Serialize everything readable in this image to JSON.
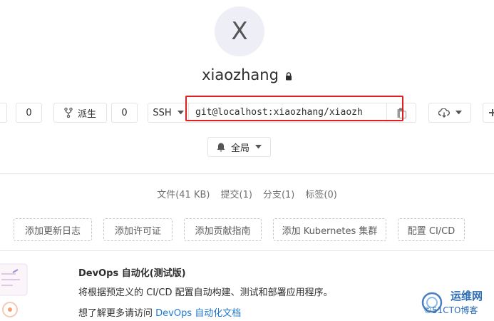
{
  "project": {
    "avatar_letter": "X",
    "name": "xiaozhang"
  },
  "toolbar": {
    "star_count": "0",
    "fork_label": "派生",
    "fork_count": "0",
    "protocol": "SSH",
    "clone_url": "git@localhost:xiaozhang/xiaozh"
  },
  "notification": {
    "level": "全局"
  },
  "stats": {
    "files_label": "文件",
    "files_size": "(41 KB)",
    "commits_label": "提交",
    "commits_count": "(1)",
    "branches_label": "分支",
    "branches_count": "(1)",
    "tags_label": "标签",
    "tags_count": "(0)"
  },
  "actions": [
    {
      "label": "添加更新日志"
    },
    {
      "label": "添加许可证"
    },
    {
      "label": "添加贡献指南"
    },
    {
      "label": "添加 Kubernetes 集群"
    },
    {
      "label": "配置 CI/CD"
    }
  ],
  "devops": {
    "title": "DevOps 自动化(测试版)",
    "description": "将根据预定义的 CI/CD 配置自动构建、测试和部署应用程序。",
    "more_prefix": "想了解更多请访问",
    "more_link": "DevOps 自动化文档"
  },
  "watermark": {
    "line1": "运维网",
    "line2": "©51CTO博客"
  },
  "colors": {
    "highlight": "#e02020",
    "link": "#1f78d1",
    "avatar_bg": "#eeeef6"
  }
}
